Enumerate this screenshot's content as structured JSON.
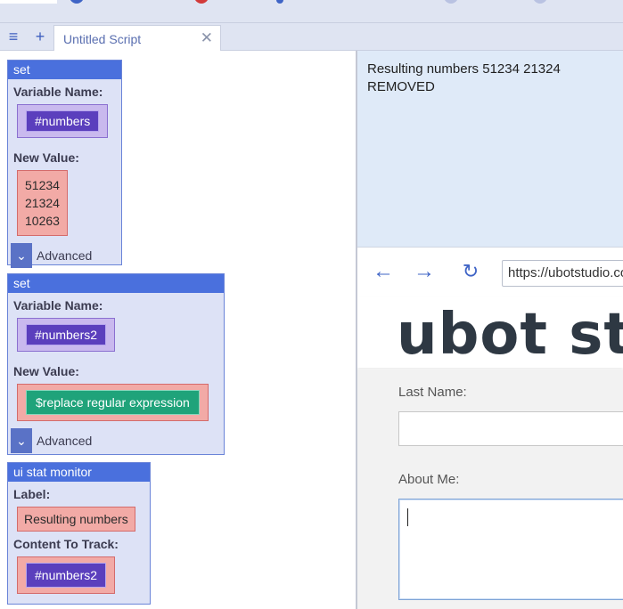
{
  "colors": {
    "accent": "#4a70dd",
    "variable_chip": "#5b3fbd",
    "function_chip": "#1fa37a",
    "value_slot": "#f2aaa6",
    "block_bg": "#dde2f6"
  },
  "tabbar": {
    "menu_icon": "hamburger-icon",
    "add_icon": "plus-icon",
    "tab_label": "Untitled Script",
    "close_icon": "close-icon",
    "close_glyph": "✕"
  },
  "commands": [
    {
      "name": "set",
      "var_label": "Variable Name:",
      "var_value": "#numbers",
      "value_label": "New Value:",
      "value_lines": [
        "51234",
        "21324",
        "10263"
      ],
      "advanced_label": "Advanced"
    },
    {
      "name": "set",
      "var_label": "Variable Name:",
      "var_value": "#numbers2",
      "value_label": "New Value:",
      "value_function": "$replace regular expression",
      "advanced_label": "Advanced"
    },
    {
      "name": "ui stat monitor",
      "label_label": "Label:",
      "label_value": "Resulting numbers",
      "track_label": "Content To Track:",
      "track_value": "#numbers2"
    }
  ],
  "stat_monitor": {
    "line1": "Resulting numbers 51234 21324",
    "line2": "REMOVED"
  },
  "browser": {
    "back_icon": "arrow-left-icon",
    "forward_icon": "arrow-right-icon",
    "reload_icon": "reload-icon",
    "url": "https://ubotstudio.com",
    "logo_text": "ubot stu",
    "last_name_label": "Last Name:",
    "last_name_value": "",
    "about_me_label": "About Me:",
    "about_me_value": ""
  }
}
